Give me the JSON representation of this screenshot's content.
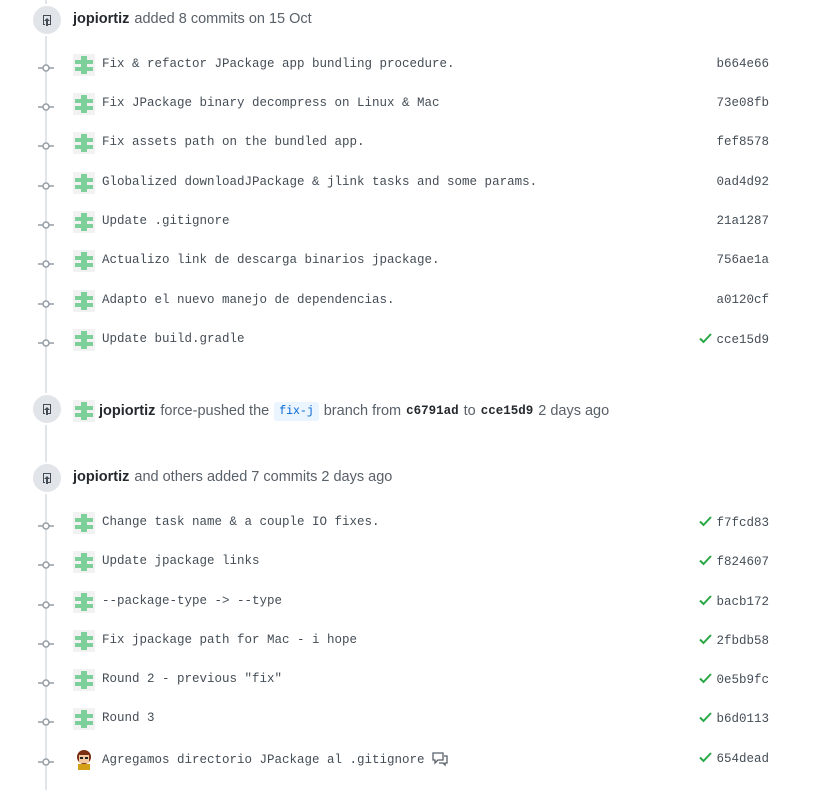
{
  "colors": {
    "accent_green": "#28a745",
    "link_blue": "#0366d6",
    "avatar_green": "#7ed09b"
  },
  "events": [
    {
      "author": "jopiortiz",
      "text": "added 8 commits on 15 Oct",
      "commits": [
        {
          "message": "Fix & refactor JPackage app bundling procedure.",
          "sha": "b664e66",
          "verified": false
        },
        {
          "message": "Fix JPackage binary decompress on Linux & Mac",
          "sha": "73e08fb",
          "verified": false
        },
        {
          "message": "Fix assets path on the bundled app.",
          "sha": "fef8578",
          "verified": false
        },
        {
          "message": "Globalized downloadJPackage & jlink tasks and some params.",
          "sha": "0ad4d92",
          "verified": false
        },
        {
          "message": "Update .gitignore",
          "sha": "21a1287",
          "verified": false
        },
        {
          "message": "Actualizo link de descarga binarios jpackage.",
          "sha": "756ae1a",
          "verified": false
        },
        {
          "message": "Adapto el nuevo manejo de dependencias.",
          "sha": "a0120cf",
          "verified": false
        },
        {
          "message": "Update build.gradle",
          "sha": "cce15d9",
          "verified": true
        }
      ]
    },
    {
      "author": "jopiortiz",
      "text_force": "force-pushed the",
      "branch": "fix-j",
      "text_branch_from": "branch from",
      "from_sha": "c6791ad",
      "text_to": "to",
      "to_sha": "cce15d9",
      "time": "2 days ago"
    },
    {
      "author": "jopiortiz",
      "text": "and others added 7 commits 2 days ago",
      "commits": [
        {
          "message": "Change task name & a couple IO fixes.",
          "sha": "f7fcd83",
          "verified": true
        },
        {
          "message": "Update jpackage links",
          "sha": "f824607",
          "verified": true
        },
        {
          "message": "--package-type -> --type",
          "sha": "bacb172",
          "verified": true
        },
        {
          "message": "Fix jpackage path for Mac - i hope",
          "sha": "2fbdb58",
          "verified": true
        },
        {
          "message": "Round 2 - previous \"fix\"",
          "sha": "0e5b9fc",
          "verified": true
        },
        {
          "message": "Round 3",
          "sha": "b6d0113",
          "verified": true
        },
        {
          "message": "Agregamos directorio JPackage al .gitignore",
          "sha": "654dead",
          "verified": true,
          "avatar": "person",
          "has_comment": true
        }
      ]
    }
  ]
}
